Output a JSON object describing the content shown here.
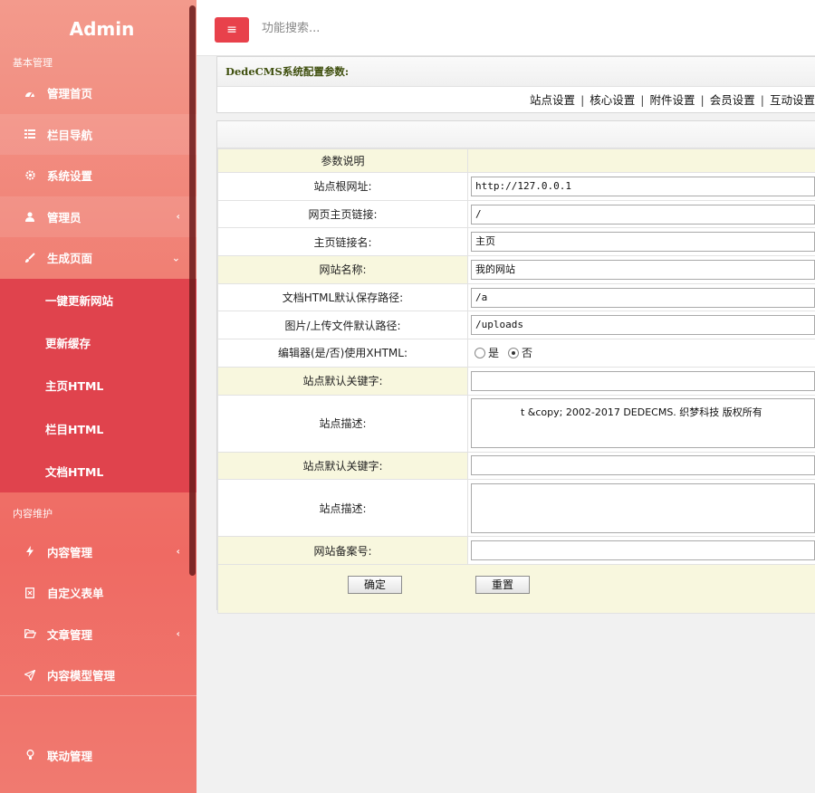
{
  "sidebar": {
    "brand": "Admin",
    "sections": {
      "basic": "基本管理",
      "content": "内容维护"
    },
    "items": [
      {
        "label": "管理首页",
        "icon": "dashboard-icon"
      },
      {
        "label": "栏目导航",
        "icon": "list-icon"
      },
      {
        "label": "系统设置",
        "icon": "gear-icon"
      },
      {
        "label": "管理员",
        "icon": "user-icon"
      },
      {
        "label": "生成页面",
        "icon": "brush-icon"
      }
    ],
    "submenu": [
      "一键更新网站",
      "更新缓存",
      "主页HTML",
      "栏目HTML",
      "文档HTML"
    ],
    "content_items": [
      {
        "label": "内容管理",
        "icon": "bolt-icon"
      },
      {
        "label": "自定义表单",
        "icon": "form-icon"
      },
      {
        "label": "文章管理",
        "icon": "folder-open-icon"
      },
      {
        "label": "内容模型管理",
        "icon": "paper-plane-icon"
      }
    ],
    "bottom_item": {
      "label": "联动管理",
      "icon": "bulb-icon"
    }
  },
  "topbar": {
    "menu_icon": "hamburger-icon",
    "search_placeholder": "功能搜索..."
  },
  "config": {
    "title": "DedeCMS系统配置参数:",
    "tabs": [
      "站点设置",
      "核心设置",
      "附件设置",
      "会员设置",
      "互动设置"
    ]
  },
  "form": {
    "header": "参数说明",
    "rows": [
      {
        "label": "站点根网址:",
        "value": "http://127.0.0.1"
      },
      {
        "label": "网页主页链接:",
        "value": "/"
      },
      {
        "label": "主页链接名:",
        "value": "主页"
      },
      {
        "label": "网站名称:",
        "value": "我的网站"
      },
      {
        "label": "文档HTML默认保存路径:",
        "value": "/a"
      },
      {
        "label": "图片/上传文件默认路径:",
        "value": "/uploads"
      }
    ],
    "xhtml": {
      "label": "编辑器(是/否)使用XHTML:",
      "yes": "是",
      "no": "否"
    },
    "keywords1": {
      "label": "站点默认关键字:",
      "value": ""
    },
    "desc1": {
      "label": "站点描述:",
      "value": "t &copy; 2002-2017 DEDECMS. 织梦科技 版权所有"
    },
    "keywords2": {
      "label": "站点默认关键字:",
      "value": ""
    },
    "desc2": {
      "label": "站点描述:",
      "value": ""
    },
    "icp": {
      "label": "网站备案号:",
      "value": ""
    },
    "submit": "确定",
    "reset": "重置"
  }
}
